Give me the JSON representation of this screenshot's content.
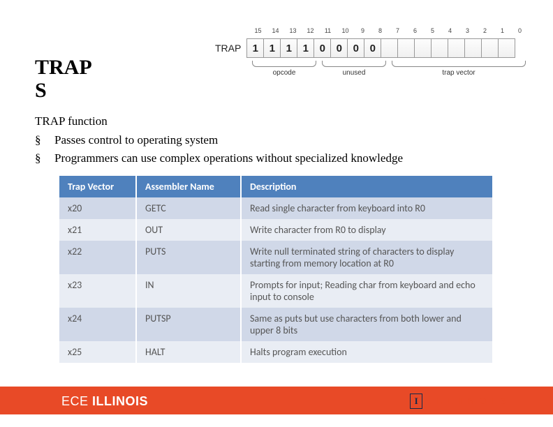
{
  "title_line1": "TRAP",
  "title_line2": "S",
  "diagram": {
    "label": "TRAP",
    "bit_numbers": [
      "15",
      "14",
      "13",
      "12",
      "11",
      "10",
      "9",
      "8",
      "7",
      "6",
      "5",
      "4",
      "3",
      "2",
      "1",
      "0"
    ],
    "cells": [
      "1",
      "1",
      "1",
      "1",
      "0",
      "0",
      "0",
      "0",
      "",
      "",
      "",
      "",
      "",
      "",
      "",
      ""
    ],
    "brace_opcode": "opcode",
    "brace_unused": "unused",
    "brace_trapvector": "trap vector"
  },
  "subtitle": "TRAP function",
  "bullet_marker": "§",
  "bullets": [
    "Passes control to operating system",
    "Programmers can use complex operations without specialized   knowledge"
  ],
  "table": {
    "headers": [
      "Trap Vector",
      "Assembler Name",
      "Description"
    ],
    "rows": [
      [
        "x20",
        "GETC",
        "Read single character from keyboard into R0"
      ],
      [
        "x21",
        "OUT",
        "Write character from R0 to display"
      ],
      [
        "x22",
        "PUTS",
        "Write null terminated string of characters to display starting from memory location at R0"
      ],
      [
        "x23",
        "IN",
        "Prompts for input; Reading char from keyboard and echo input to console"
      ],
      [
        "x24",
        "PUTSP",
        "Same as puts but use characters from both lower and upper 8 bits"
      ],
      [
        "x25",
        "HALT",
        "Halts program execution"
      ]
    ]
  },
  "footer": {
    "ece_thin": "ECE ",
    "ece_bold": "ILLINOIS",
    "block_i": "I",
    "illinois_spaced": "ILLINOIS"
  }
}
